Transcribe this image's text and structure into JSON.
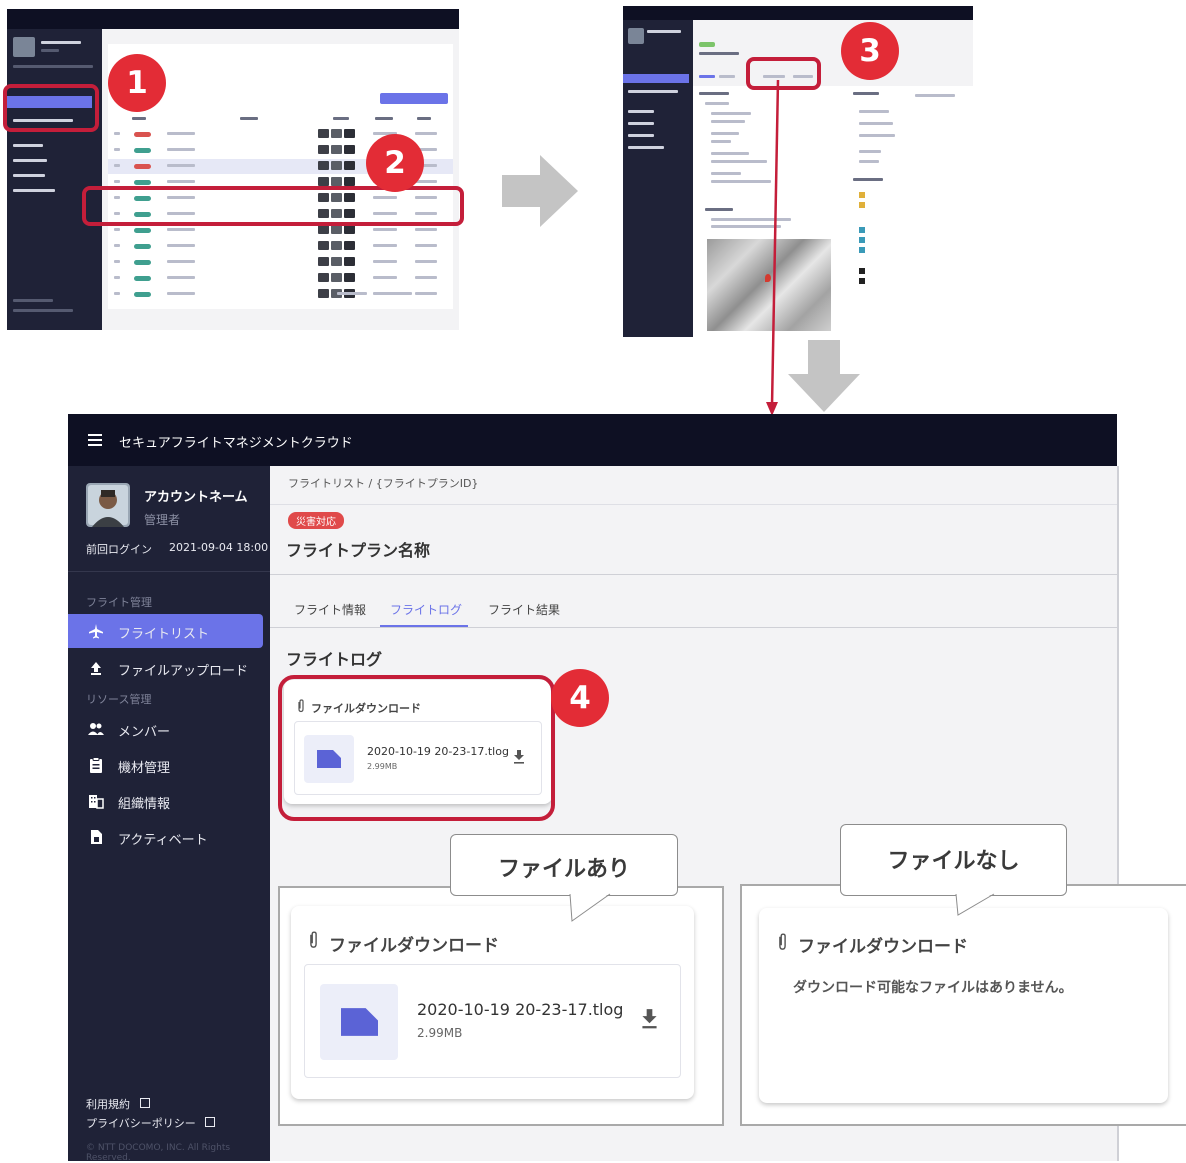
{
  "app": {
    "title": "セキュアフライトマネジメントクラウド"
  },
  "account": {
    "name": "アカウントネーム",
    "role": "管理者",
    "last_login_label": "前回ログイン",
    "last_login_value": "2021-09-04 18:00"
  },
  "sidebar": {
    "section_flight": "フライト管理",
    "section_resource": "リソース管理",
    "items": [
      {
        "label": "フライトリスト",
        "icon": "airplane-icon",
        "active": true
      },
      {
        "label": "ファイルアップロード",
        "icon": "upload-icon",
        "active": false
      },
      {
        "label": "メンバー",
        "icon": "people-icon",
        "active": false
      },
      {
        "label": "機材管理",
        "icon": "clipboard-icon",
        "active": false
      },
      {
        "label": "組織情報",
        "icon": "building-icon",
        "active": false
      },
      {
        "label": "アクティベート",
        "icon": "sim-icon",
        "active": false
      }
    ],
    "terms": "利用規約",
    "privacy": "プライバシーポリシー",
    "copyright": "© NTT DOCOMO, INC. All Rights Reserved."
  },
  "page": {
    "breadcrumb": "フライトリスト / {フライトプランID}",
    "tag": "災害対応",
    "title": "フライトプラン名称",
    "tabs": [
      "フライト情報",
      "フライトログ",
      "フライト結果"
    ],
    "active_tab": 1,
    "section_title": "フライトログ"
  },
  "download": {
    "card_title": "ファイルダウンロード",
    "file_name": "2020-10-19 20-23-17.tlog",
    "file_size": "2.99MB",
    "empty_message": "ダウンロード可能なファイルはありません。"
  },
  "callouts": {
    "with_file": "ファイルあり",
    "no_file": "ファイルなし"
  },
  "steps": [
    "1",
    "2",
    "3",
    "4"
  ],
  "colors": {
    "topbar": "#0e1023",
    "sidebar": "#1f2237",
    "accent": "#6b73e8",
    "badge_red": "#e32c36",
    "tag_red": "#e04a4a"
  }
}
